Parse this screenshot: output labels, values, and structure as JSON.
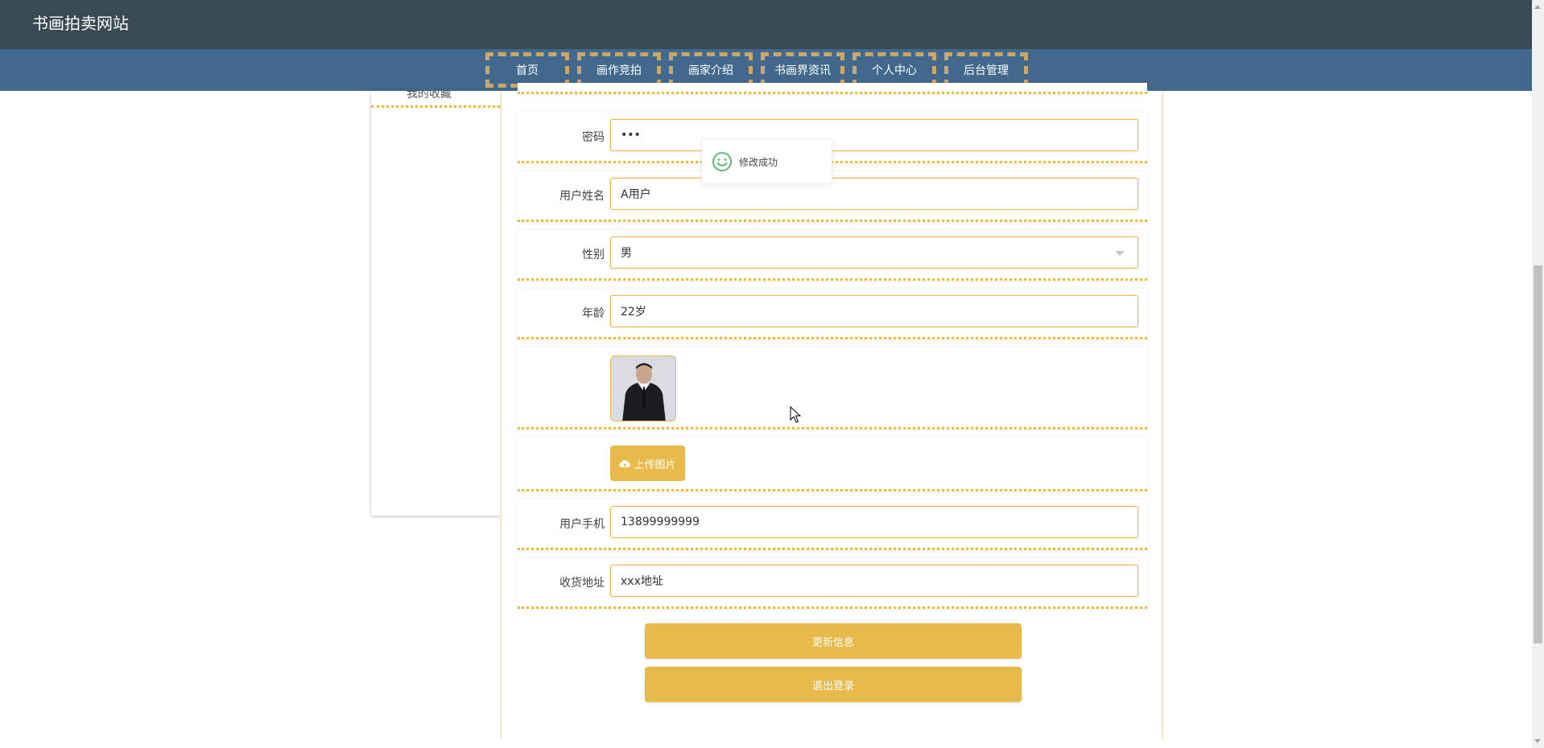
{
  "header": {
    "site_title": "书画拍卖网站"
  },
  "nav": {
    "items": [
      {
        "label": "首页"
      },
      {
        "label": "画作竞拍"
      },
      {
        "label": "画家介绍"
      },
      {
        "label": "书画界资讯"
      },
      {
        "label": "个人中心"
      },
      {
        "label": "后台管理"
      }
    ]
  },
  "sidebar": {
    "partial_item_label": "我的收藏"
  },
  "form": {
    "password": {
      "label": "密码",
      "value": "•••"
    },
    "name": {
      "label": "用户姓名",
      "value": "A用户"
    },
    "gender": {
      "label": "性别",
      "value": "男"
    },
    "age": {
      "label": "年龄",
      "value": "22岁"
    },
    "avatar": {
      "icon": "user-photo"
    },
    "upload": {
      "label": "上传图片",
      "icon": "cloud-upload-icon"
    },
    "phone": {
      "label": "用户手机",
      "value": "13899999999"
    },
    "address": {
      "label": "收货地址",
      "value": "xxx地址"
    }
  },
  "actions": {
    "update_label": "更新信息",
    "logout_label": "退出登录"
  },
  "toast": {
    "message": "修改成功",
    "icon": "smile-icon"
  },
  "colors": {
    "accent": "#e8b94b",
    "topbar": "#3a4a55",
    "navbar": "#42698d",
    "nav_border": "#c9a66a"
  }
}
